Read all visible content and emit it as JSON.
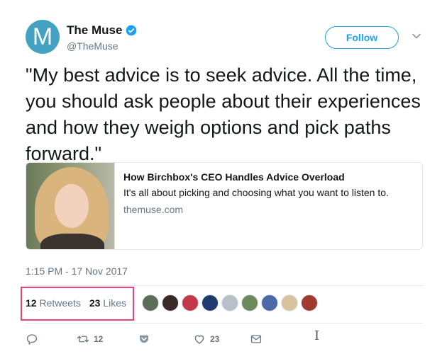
{
  "author": {
    "avatar_letter": "M",
    "avatar_color": "#45a2c3",
    "display_name": "The Muse",
    "handle": "@TheMuse",
    "verified": true
  },
  "follow_label": "Follow",
  "tweet_text": "\"My best advice is to seek advice. All the time, you should ask people about their experiences and how they weigh options and pick paths forward.\"",
  "card": {
    "title": "How Birchbox's CEO Handles Advice Overload",
    "description": "It's all about picking and choosing what you want to listen to.",
    "domain": "themuse.com"
  },
  "timestamp": "1:15 PM - 17 Nov 2017",
  "stats": {
    "retweets_count": "12",
    "retweets_label": "Retweets",
    "likes_count": "23",
    "likes_label": "Likes"
  },
  "liker_colors": [
    "#5b6e5a",
    "#3a2a26",
    "#c23a4a",
    "#1f3b6e",
    "#b8c0c8",
    "#6d8a5c",
    "#4a6aa8",
    "#d8c2a0",
    "#a03a2e"
  ],
  "actions": {
    "reply_icon": "reply-icon",
    "retweet_count": "12",
    "like_count": "23"
  },
  "colors": {
    "accent": "#1da1f2",
    "highlight_border": "#e8437b",
    "secondary_text": "#657786"
  }
}
